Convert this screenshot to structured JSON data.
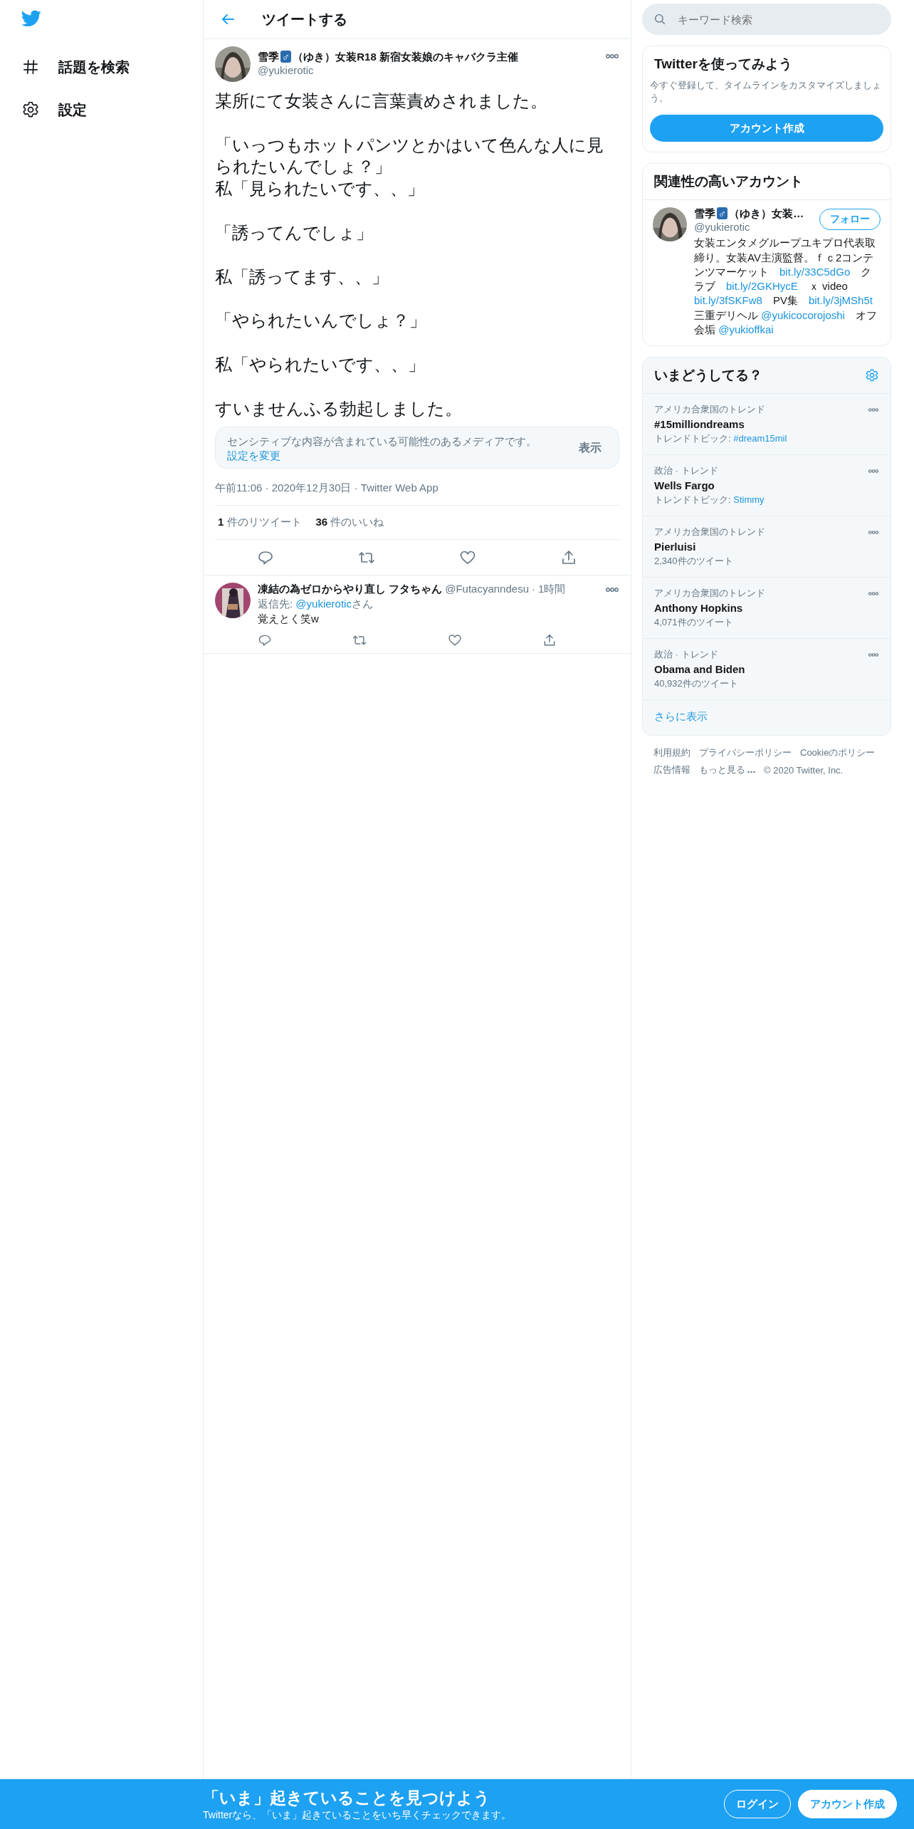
{
  "sidebar": {
    "items": [
      {
        "kind": "hash",
        "label": "話題を検索"
      },
      {
        "kind": "gear",
        "label": "設定"
      }
    ]
  },
  "header": {
    "title": "ツイートする"
  },
  "tweet": {
    "name_start": "雪季",
    "name_badge": "♂",
    "name_end": "（ゆき）女装R18 新宿女装娘のキャバクラ主催",
    "handle": "@yukierotic",
    "paragraphs": [
      [
        "某所にて女装さんに言葉責めされました。"
      ],
      [
        "「いっつもホットパンツとかはいて色んな人に見られたいんでしょ？」",
        "私「見られたいです、、」"
      ],
      [
        "「誘ってんでしょ」"
      ],
      [
        "私「誘ってます、、」"
      ],
      [
        "「やられたいんでしょ？」"
      ],
      [
        "私「やられたいです、、」"
      ],
      [
        "すいませんふる勃起しました。"
      ]
    ],
    "sensitive": {
      "text": "センシティブな内容が含まれている可能性のあるメディアです。",
      "link": "設定を変更",
      "button": "表示"
    },
    "meta": "午前11:06 · 2020年12月30日 · Twitter Web App",
    "stats": [
      {
        "count": "1",
        "label": "件のリツイート"
      },
      {
        "count": "36",
        "label": "件のいいね"
      }
    ]
  },
  "replies": [
    {
      "name": "凍結の為ゼロからやり直し フタちゃん",
      "handle": "@Futacyanndesu",
      "separator": "·",
      "time": "1時間",
      "reply_prefix": "返信先: ",
      "reply_link": "@yukierotic",
      "reply_suffix": "さん",
      "text": "覚えとく笑w"
    }
  ],
  "search": {
    "placeholder": "キーワード検索"
  },
  "signup_card": {
    "title": "Twitterを使ってみよう",
    "text": "今すぐ登録して、タイムラインをカスタマイズしましょう。",
    "button": "アカウント作成"
  },
  "related": {
    "title": "関連性の高いアカウント",
    "accounts": [
      {
        "name_start": "雪季",
        "name_badge": "♂",
        "name_end": "（ゆき）女装…",
        "handle": "@yukierotic",
        "button": "フォロー",
        "bio": [
          {
            "text": "女装エンタメグループユキプロ代表取締り。女装AV主演監督。ｆｃ2コンテンツマーケット　",
            "kind": "text"
          },
          {
            "text": "bit.ly/33C5dGo",
            "kind": "link"
          },
          {
            "text": "　クラブ　",
            "kind": "text"
          },
          {
            "text": "bit.ly/2GKHycE",
            "kind": "link"
          },
          {
            "text": "　ｘ video　",
            "kind": "text"
          },
          {
            "text": "bit.ly/3fSKFw8",
            "kind": "link"
          },
          {
            "text": "　PV集　",
            "kind": "text"
          },
          {
            "text": "bit.ly/3jMSh5t",
            "kind": "link"
          },
          {
            "text": " 三重デリヘル ",
            "kind": "text"
          },
          {
            "text": "@yukicocorojoshi",
            "kind": "link"
          },
          {
            "text": "　オフ会垢 ",
            "kind": "text"
          },
          {
            "text": "@yukioffkai",
            "kind": "link"
          }
        ]
      }
    ]
  },
  "trends": {
    "title": "いまどうしてる？",
    "items": [
      {
        "category": "アメリカ合衆国のトレンド",
        "name": "#15milliondreams",
        "detail": "トレンドトピック: ",
        "detail_link": "#dream15mil"
      },
      {
        "category": "政治 · トレンド",
        "name": "Wells Fargo",
        "detail": "トレンドトピック: ",
        "detail_link": "Stimmy"
      },
      {
        "category": "アメリカ合衆国のトレンド",
        "name": "Pierluisi",
        "detail": "2,340件のツイート"
      },
      {
        "category": "アメリカ合衆国のトレンド",
        "name": "Anthony Hopkins",
        "detail": "4,071件のツイート"
      },
      {
        "category": "政治 · トレンド",
        "name": "Obama and Biden",
        "detail": "40,932件のツイート"
      }
    ],
    "more": "さらに表示"
  },
  "footer": {
    "links": [
      {
        "kind": "link",
        "label": "利用規約"
      },
      {
        "kind": "link",
        "label": "プライバシーポリシー"
      },
      {
        "kind": "link",
        "label": "Cookieのポリシー"
      },
      {
        "kind": "link",
        "label": "広告情報"
      },
      {
        "kind": "menu",
        "label": "もっと見る"
      }
    ],
    "copyright": "© 2020 Twitter, Inc."
  },
  "banner": {
    "title": "「いま」起きていることを見つけよう",
    "text": "Twitterなら、「いま」起きていることをいち早くチェックできます。",
    "buttons": [
      {
        "kind": "outline",
        "label": "ログイン"
      },
      {
        "kind": "filled",
        "label": "アカウント作成"
      }
    ]
  }
}
